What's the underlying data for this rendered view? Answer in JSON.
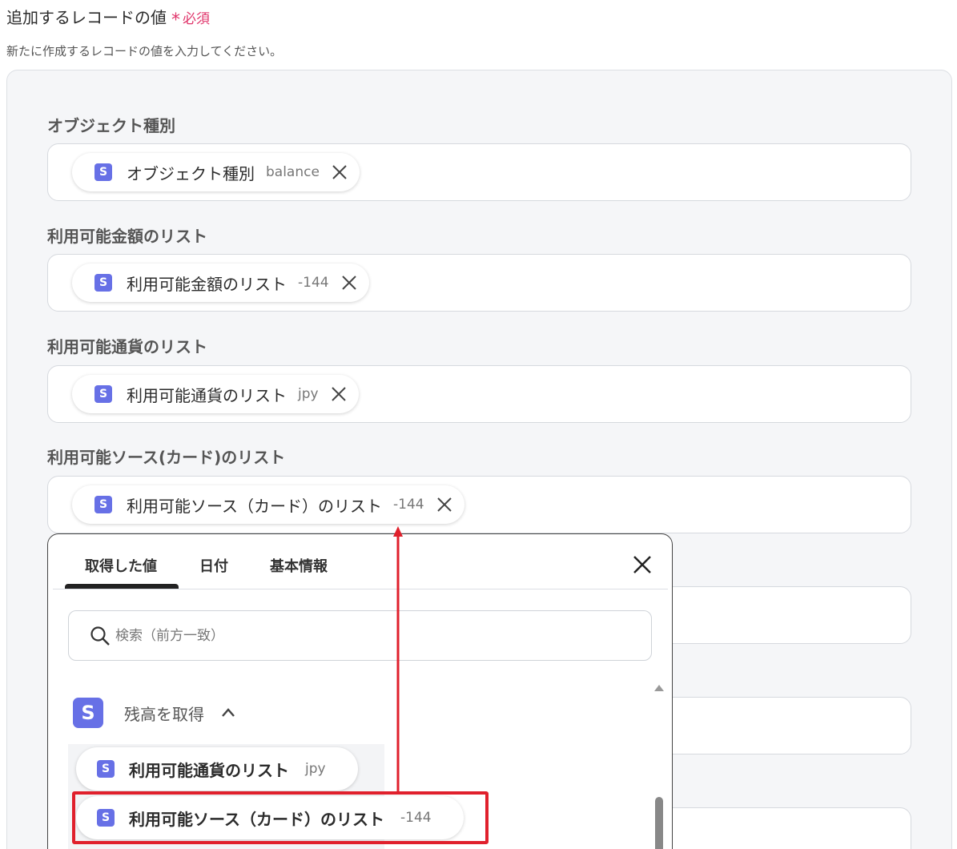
{
  "section": {
    "title": "追加するレコードの値",
    "required_label": "必須",
    "description": "新たに作成するレコードの値を入力してください。"
  },
  "fields": [
    {
      "label": "オブジェクト種別",
      "chip_label": "オブジェクト種別",
      "chip_value": "balance"
    },
    {
      "label": "利用可能金額のリスト",
      "chip_label": "利用可能金額のリスト",
      "chip_value": "-144"
    },
    {
      "label": "利用可能通貨のリスト",
      "chip_label": "利用可能通貨のリスト",
      "chip_value": "jpy"
    },
    {
      "label": "利用可能ソース(カード)のリスト",
      "chip_label": "利用可能ソース（カード）のリスト",
      "chip_value": "-144"
    }
  ],
  "popup": {
    "tabs": [
      "取得した値",
      "日付",
      "基本情報"
    ],
    "search_placeholder": "検索（前方一致）",
    "group_icon_letter": "S",
    "group_title": "残高を取得",
    "items": [
      {
        "label": "利用可能通貨のリスト",
        "value": "jpy"
      },
      {
        "label": "利用可能ソース（カード）のリスト",
        "value": "-144"
      }
    ]
  },
  "icon_letter": "S",
  "colors": {
    "accent": "#6770e6",
    "required": "#e0356b",
    "highlight": "#e0202c"
  }
}
